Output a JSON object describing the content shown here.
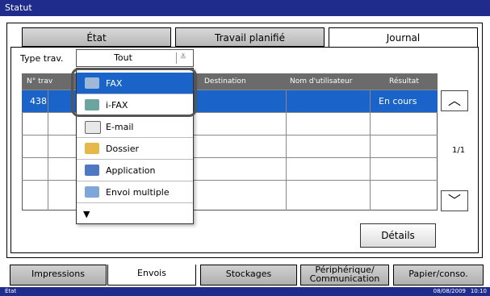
{
  "title": "Statut",
  "tabs": [
    "État",
    "Travail planifié",
    "Journal"
  ],
  "filter": {
    "label": "Type trav.",
    "value": "Tout"
  },
  "table": {
    "headers": [
      "N° trav",
      "Destination",
      "Nom d'utilisateur",
      "Résultat"
    ],
    "rows": [
      {
        "id": "438",
        "result": "En cours"
      }
    ],
    "page": "1/1"
  },
  "menu": [
    {
      "label": "FAX",
      "icon": "fax-icon"
    },
    {
      "label": "i-FAX",
      "icon": "ifax-icon"
    },
    {
      "label": "E-mail",
      "icon": "email-icon"
    },
    {
      "label": "Dossier",
      "icon": "folder-icon"
    },
    {
      "label": "Application",
      "icon": "application-icon"
    },
    {
      "label": "Envoi multiple",
      "icon": "multi-send-icon"
    }
  ],
  "buttons": {
    "details": "Détails"
  },
  "bottom_tabs": [
    "Impressions",
    "Envois",
    "Stockages",
    "Périphérique/",
    "Communication",
    "Papier/conso."
  ],
  "status": {
    "left": "État",
    "datetime": "08/08/2009",
    "time": "10:10"
  }
}
